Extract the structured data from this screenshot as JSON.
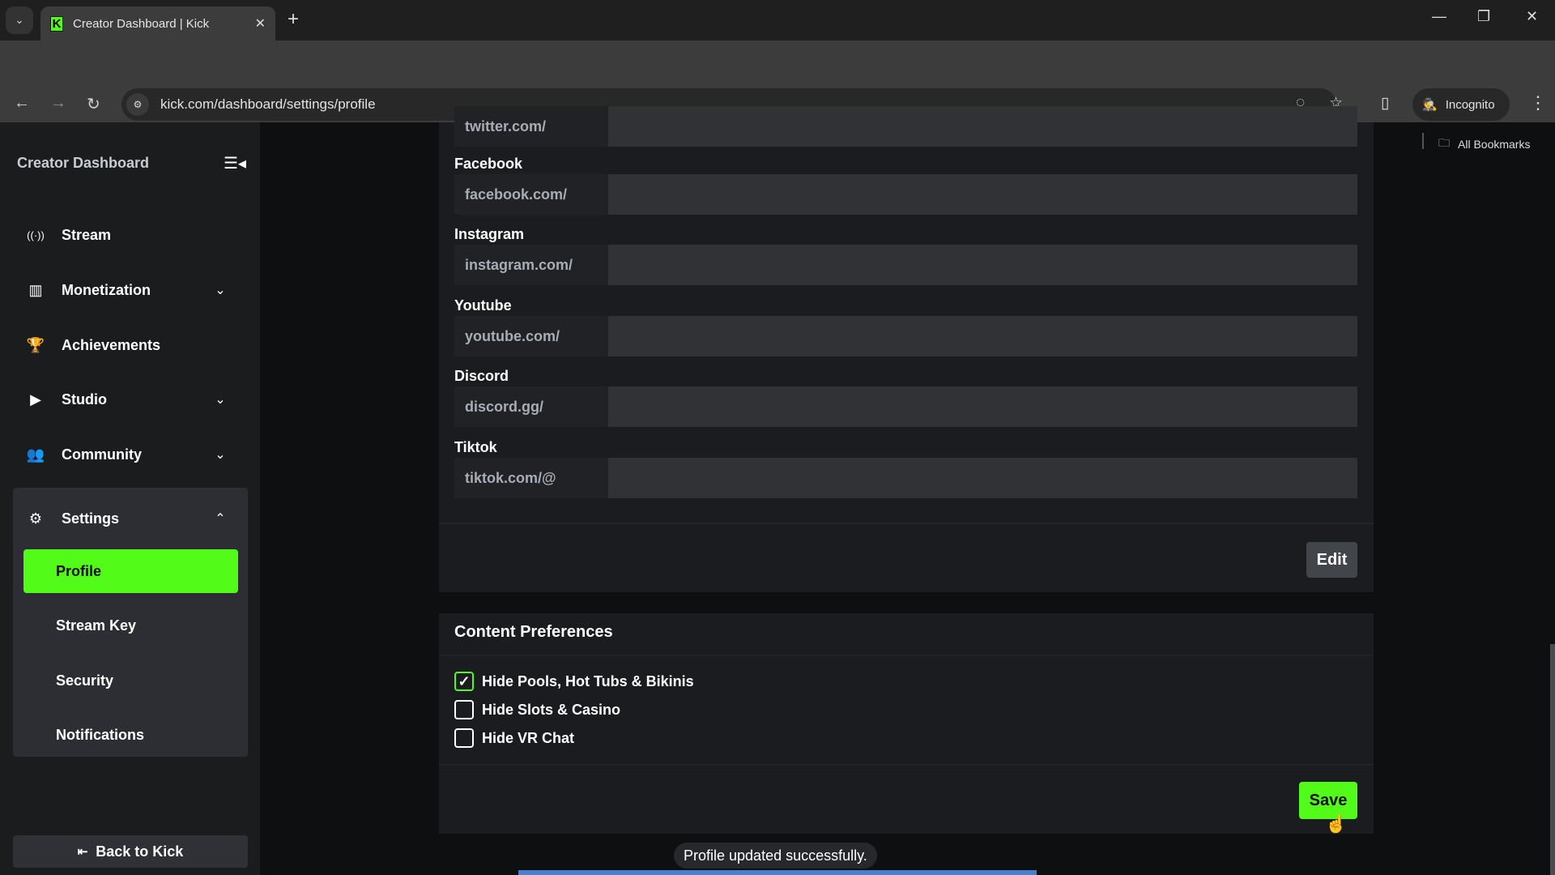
{
  "browser": {
    "tab_title": "Creator Dashboard | Kick",
    "favicon_letter": "K",
    "url": "kick.com/dashboard/settings/profile",
    "incognito_label": "Incognito",
    "bookmarks_label": "All Bookmarks",
    "icons": {
      "tab_menu": "⌄",
      "tab_close": "✕",
      "new_tab": "+",
      "minimize": "—",
      "restore": "❐",
      "close": "✕",
      "back": "←",
      "forward": "→",
      "reload": "↻",
      "site_info": "⚙",
      "eye_off": "◌",
      "star": "☆",
      "side_panel": "▯",
      "incognito": "🕵",
      "menu": "⋮",
      "folder": "🗀"
    }
  },
  "sidebar": {
    "title": "Creator Dashboard",
    "collapse_icon": "☰◂",
    "items": [
      {
        "label": "Stream",
        "icon": "((·))",
        "has_chevron": false
      },
      {
        "label": "Monetization",
        "icon": "▥",
        "has_chevron": true,
        "chevron": "⌄"
      },
      {
        "label": "Achievements",
        "icon": "🏆",
        "has_chevron": false
      },
      {
        "label": "Studio",
        "icon": "▶",
        "has_chevron": true,
        "chevron": "⌄"
      },
      {
        "label": "Community",
        "icon": "👥",
        "has_chevron": true,
        "chevron": "⌄"
      }
    ],
    "settings": {
      "label": "Settings",
      "icon": "⚙",
      "chevron": "⌃",
      "sub_items": [
        {
          "label": "Profile",
          "active": true
        },
        {
          "label": "Stream Key",
          "active": false
        },
        {
          "label": "Security",
          "active": false
        },
        {
          "label": "Notifications",
          "active": false
        }
      ]
    },
    "back_label": "Back to Kick",
    "back_icon": "⇤"
  },
  "socials": {
    "partial_prefix": "twitter.com/",
    "fields": [
      {
        "label": "Facebook",
        "prefix": "facebook.com/",
        "value": ""
      },
      {
        "label": "Instagram",
        "prefix": "instagram.com/",
        "value": ""
      },
      {
        "label": "Youtube",
        "prefix": "youtube.com/",
        "value": ""
      },
      {
        "label": "Discord",
        "prefix": "discord.gg/",
        "value": ""
      },
      {
        "label": "Tiktok",
        "prefix": "tiktok.com/@",
        "value": ""
      }
    ],
    "edit_label": "Edit"
  },
  "content_preferences": {
    "title": "Content Preferences",
    "options": [
      {
        "label": "Hide Pools, Hot Tubs & Bikinis",
        "checked": true
      },
      {
        "label": "Hide Slots & Casino",
        "checked": false
      },
      {
        "label": "Hide VR Chat",
        "checked": false
      }
    ],
    "save_label": "Save",
    "check_glyph": "✓"
  },
  "toast": {
    "message": "Profile updated successfully."
  },
  "colors": {
    "accent": "#53fc18",
    "sidebar_bg": "#1a1c1e",
    "page_bg": "#0e0f11",
    "panel_bg": "#1a1c1f"
  }
}
